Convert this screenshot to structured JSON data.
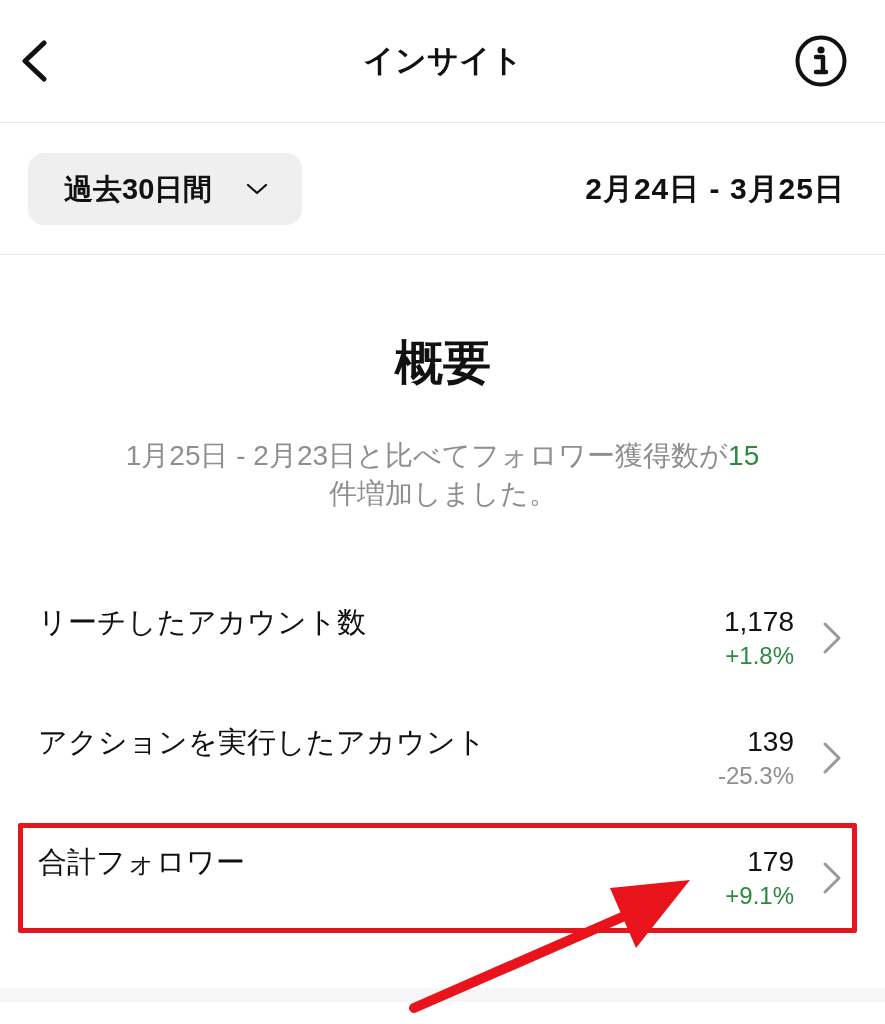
{
  "header": {
    "title": "インサイト"
  },
  "filter": {
    "period": "過去30日間",
    "date_range": "2月24日 - 3月25日"
  },
  "overview": {
    "title": "概要",
    "comparison": {
      "text": "1月25日 - 2月23日と比べてフォロワー獲得数が",
      "count": "15",
      "suffix": "件増加しました。"
    }
  },
  "metrics": [
    {
      "label": "リーチしたアカウント数",
      "value": "1,178",
      "change": "+1.8%",
      "color": "#2b8a3e",
      "highlighted": false
    },
    {
      "label": "アクションを実行したアカウント",
      "value": "139",
      "change": "-25.3%",
      "color": "#8e8e8e",
      "highlighted": false
    },
    {
      "label": "合計フォロワー",
      "value": "179",
      "change": "+9.1%",
      "color": "#2b8a3e",
      "highlighted": true
    }
  ]
}
